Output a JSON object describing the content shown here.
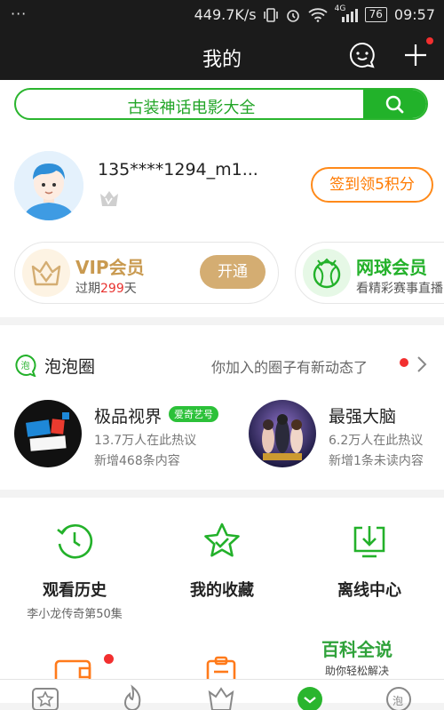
{
  "status_bar": {
    "dots": "···",
    "speed": "449.7K/s",
    "network": "4G",
    "battery": "76",
    "time": "09:57"
  },
  "nav": {
    "title": "我的"
  },
  "search": {
    "placeholder": "古装神话电影大全"
  },
  "profile": {
    "username": "135****1294_m1...",
    "checkin_button": "签到领5积分"
  },
  "vip": {
    "title": "VIP会员",
    "expire_prefix": "过期",
    "expire_days": "299",
    "expire_suffix": "天",
    "open_button": "开通"
  },
  "tennis": {
    "title": "网球会员",
    "subtitle": "看精彩赛事直播"
  },
  "paopao": {
    "title": "泡泡圈",
    "note": "你加入的圈子有新动态了",
    "groups": [
      {
        "name": "极品视界",
        "tag": "爱奇艺号",
        "line1": "13.7万人在此热议",
        "line2": "新增468条内容"
      },
      {
        "name": "最强大脑",
        "tag": "",
        "line1": "6.2万人在此热议",
        "line2": "新增1条未读内容"
      }
    ]
  },
  "features": [
    {
      "label": "观看历史",
      "sub": "李小龙传奇第50集"
    },
    {
      "label": "我的收藏",
      "sub": ""
    },
    {
      "label": "离线中心",
      "sub": ""
    }
  ],
  "watermark": {
    "title": "百科全说",
    "subtitle": "助你轻松解决"
  },
  "colors": {
    "brand_green": "#22b22a",
    "orange": "#ff7a00",
    "gold": "#d4ad72",
    "red_dot": "#f22f2f"
  }
}
